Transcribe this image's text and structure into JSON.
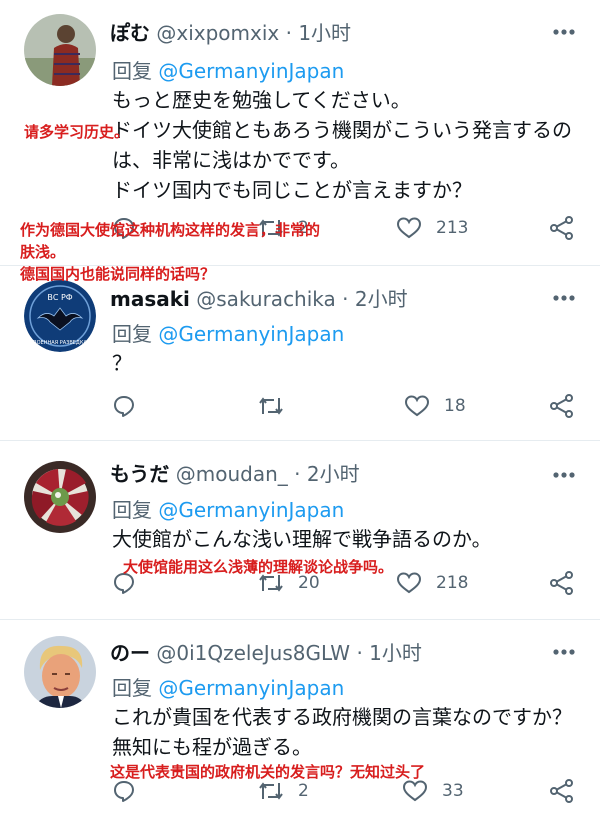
{
  "tweets": [
    {
      "name": "ぽむ",
      "handle": "@xixpomxix",
      "dot": "·",
      "time": "1小时",
      "reply_label": "回复",
      "reply_to": "@GermanyinJapan",
      "text": "もっと歴史を勉強してください。\nドイツ大使館ともあろう機関がこういう発言するのは、非常に浅はかでです。\nドイツ国内でも同じことが言えますか？",
      "retweets": "2",
      "likes": "213",
      "avatar_icon": "user-photo-avatar"
    },
    {
      "name": "masaki",
      "handle": "@sakurachika",
      "dot": "·",
      "time": "2小时",
      "reply_label": "回复",
      "reply_to": "@GermanyinJapan",
      "text": "？",
      "retweets": "",
      "likes": "18",
      "avatar_icon": "military-emblem-avatar",
      "avatar_text_top": "ВС РФ",
      "avatar_text_ring": "ВОЕННАЯ РАЗВЕДКА"
    },
    {
      "name": "もうだ",
      "handle": "@moudan_",
      "dot": "·",
      "time": "2小时",
      "reply_label": "回复",
      "reply_to": "@GermanyinJapan",
      "text": "大使館がこんな浅い理解で戦争語るのか。",
      "retweets": "20",
      "likes": "218",
      "avatar_icon": "food-photo-avatar"
    },
    {
      "name": "のー",
      "handle": "@0i1QzeleJus8GLW",
      "dot": "·",
      "time": "1小时",
      "reply_label": "回复",
      "reply_to": "@GermanyinJapan",
      "text": "これが貴国を代表する政府機関の言葉なのですか？無知にも程が過ぎる。",
      "retweets": "2",
      "likes": "33",
      "avatar_icon": "portrait-photo-avatar"
    }
  ],
  "annotations": {
    "a1": "请多学习历史。",
    "a2": "作为德国大使馆这种机构这样的发言，非常的\n肤浅。\n德国国内也能说同样的话吗？",
    "a3": "大使馆能用这么浅薄的理解谈论战争吗。",
    "a4": "这是代表贵国的政府机关的发言吗？无知过头了"
  },
  "colors": {
    "annotation_red": "#d81e1e",
    "mention_blue": "#1d9bf0",
    "secondary_gray": "#536471"
  }
}
